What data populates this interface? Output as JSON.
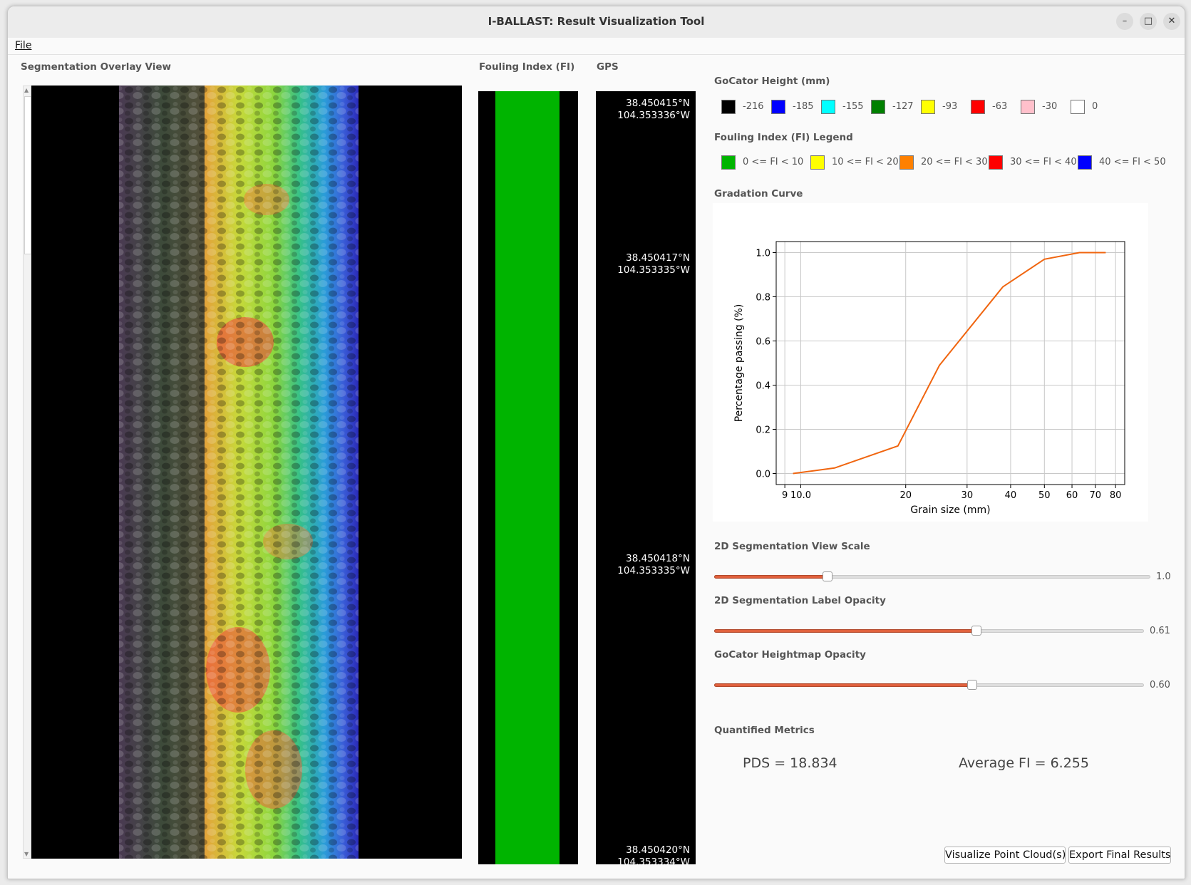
{
  "window": {
    "title": "I-BALLAST: Result Visualization Tool"
  },
  "menu": {
    "file_label": "File"
  },
  "panels": {
    "segmentation_label": "Segmentation Overlay View",
    "fouling_label": "Fouling Index (FI)",
    "gps_label": "GPS"
  },
  "gps": [
    {
      "lat": "38.450415°N",
      "lon": "104.353336°W"
    },
    {
      "lat": "38.450417°N",
      "lon": "104.353335°W"
    },
    {
      "lat": "38.450418°N",
      "lon": "104.353335°W"
    },
    {
      "lat": "38.450420°N",
      "lon": "104.353334°W"
    }
  ],
  "gocator": {
    "label": "GoCator Height (mm)",
    "items": [
      {
        "color": "#000000",
        "value": "-216"
      },
      {
        "color": "#0000ff",
        "value": "-185"
      },
      {
        "color": "#00ffff",
        "value": "-155"
      },
      {
        "color": "#008000",
        "value": "-127"
      },
      {
        "color": "#ffff00",
        "value": "-93"
      },
      {
        "color": "#ff0000",
        "value": "-63"
      },
      {
        "color": "#ffc0cb",
        "value": "-30"
      },
      {
        "color": "#ffffff",
        "value": "0"
      }
    ]
  },
  "fi_legend": {
    "label": "Fouling Index (FI) Legend",
    "items": [
      {
        "color": "#00b400",
        "text": "0 <= FI < 10"
      },
      {
        "color": "#ffff00",
        "text": "10 <= FI < 20"
      },
      {
        "color": "#ff8000",
        "text": "20 <= FI < 30"
      },
      {
        "color": "#ff0000",
        "text": "30 <= FI < 40"
      },
      {
        "color": "#0000ff",
        "text": "40 <= FI < 50"
      }
    ]
  },
  "gradation_label": "Gradation Curve",
  "chart_data": {
    "type": "line",
    "xlabel": "Grain size (mm)",
    "ylabel": "Percentage passing (%)",
    "xscale": "log",
    "xlim": [
      8.5,
      85
    ],
    "ylim": [
      -0.05,
      1.05
    ],
    "x_ticks": [
      "9",
      "10.0",
      "20",
      "30",
      "40",
      "50",
      "60",
      "70",
      "80"
    ],
    "y_ticks": [
      "0.0",
      "0.2",
      "0.4",
      "0.6",
      "0.8",
      "1.0"
    ],
    "grid": true,
    "series": [
      {
        "color": "#f0650f",
        "x": [
          9.5,
          12.5,
          19,
          25,
          38,
          50,
          63,
          75
        ],
        "y": [
          0.0,
          0.025,
          0.125,
          0.49,
          0.845,
          0.97,
          1.0,
          1.0
        ]
      }
    ]
  },
  "sliders": [
    {
      "label": "2D Segmentation View Scale",
      "value": "1.0",
      "fraction": 0.26
    },
    {
      "label": "2D Segmentation Label Opacity",
      "value": "0.61",
      "fraction": 0.61
    },
    {
      "label": "GoCator Heightmap Opacity",
      "value": "0.60",
      "fraction": 0.6
    }
  ],
  "metrics": {
    "label": "Quantified Metrics",
    "pds": "PDS = 18.834",
    "avg_fi": "Average FI = 6.255"
  },
  "buttons": {
    "visualize": "Visualize Point Cloud(s)",
    "export": "Export Final Results"
  }
}
